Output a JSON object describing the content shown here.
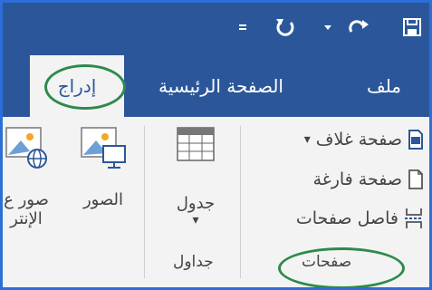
{
  "qat": {
    "save_icon": "save-icon",
    "redo_icon": "redo-icon",
    "customize_icon": "customize-qat-icon",
    "undo_icon": "undo-icon",
    "touch_icon": "touch-mode-icon"
  },
  "tabs": [
    {
      "label": "ملف"
    },
    {
      "label": "الصفحة الرئيسية"
    },
    {
      "label": "إدراج"
    }
  ],
  "groups": {
    "pages": {
      "label": "صفحات",
      "items": [
        {
          "label": "صفحة غلاف",
          "icon": "cover-page-icon",
          "dropdown": "▾"
        },
        {
          "label": "صفحة فارغة",
          "icon": "blank-page-icon"
        },
        {
          "label": "فاصل صفحات",
          "icon": "page-break-icon"
        }
      ]
    },
    "tables": {
      "label": "جداول",
      "items": [
        {
          "label": "جدول",
          "dropdown": "▾",
          "icon": "table-icon"
        }
      ]
    },
    "illustrations": {
      "items": [
        {
          "label": "الصور",
          "icon": "pictures-icon"
        },
        {
          "label": "صور ع",
          "label2": "الإنتر",
          "icon": "online-pictures-icon"
        }
      ]
    }
  },
  "colors": {
    "accent": "#2b579a",
    "ribbon_bg": "#f3f3f3",
    "highlight": "#2e8a4b",
    "frame": "#2c6fd6"
  }
}
